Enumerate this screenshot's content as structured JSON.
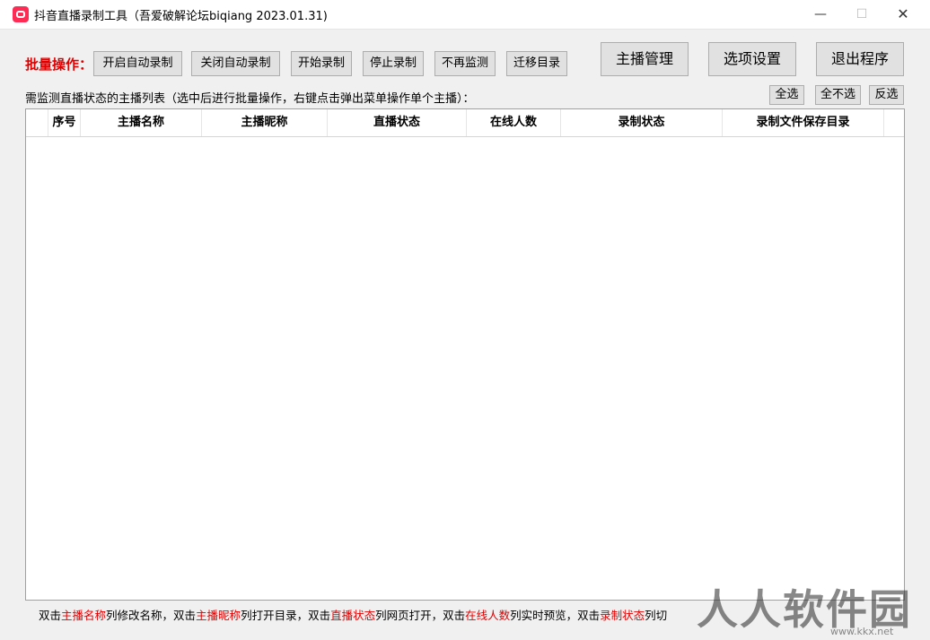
{
  "window": {
    "title": "抖音直播录制工具（吾爱破解论坛biqiang 2023.01.31)",
    "min_glyph": "—",
    "max_glyph": "☐",
    "close_glyph": "✕"
  },
  "toolbar": {
    "batch_label": "批量操作：",
    "buttons": [
      "开启自动录制",
      "关闭自动录制",
      "开始录制",
      "停止录制",
      "不再监测",
      "迁移目录"
    ],
    "big_buttons": [
      "主播管理",
      "选项设置",
      "退出程序"
    ]
  },
  "list": {
    "label": "需监测直播状态的主播列表（选中后进行批量操作，右键点击弹出菜单操作单个主播）：",
    "select_all": "全选",
    "select_none": "全不选",
    "invert": "反选",
    "columns": [
      "",
      "序号",
      "主播名称",
      "主播昵称",
      "直播状态",
      "在线人数",
      "录制状态",
      "录制文件保存目录"
    ]
  },
  "hint": {
    "parts": [
      {
        "text": "双击",
        "red": false
      },
      {
        "text": "主播名称",
        "red": true
      },
      {
        "text": "列修改名称，双击",
        "red": false
      },
      {
        "text": "主播昵称",
        "red": true
      },
      {
        "text": "列打开目录，双击",
        "red": false
      },
      {
        "text": "直播状态",
        "red": true
      },
      {
        "text": "列网页打开，双击",
        "red": false
      },
      {
        "text": "在线人数",
        "red": true
      },
      {
        "text": "列实时预览，双击",
        "red": false
      },
      {
        "text": "录制状态",
        "red": true
      },
      {
        "text": "列切",
        "red": false
      }
    ]
  },
  "watermark": {
    "text": "人人软件园",
    "sub": "www.kkx.net"
  },
  "colors": {
    "accent_red": "#e00000",
    "app_icon": "#fe2c55"
  }
}
